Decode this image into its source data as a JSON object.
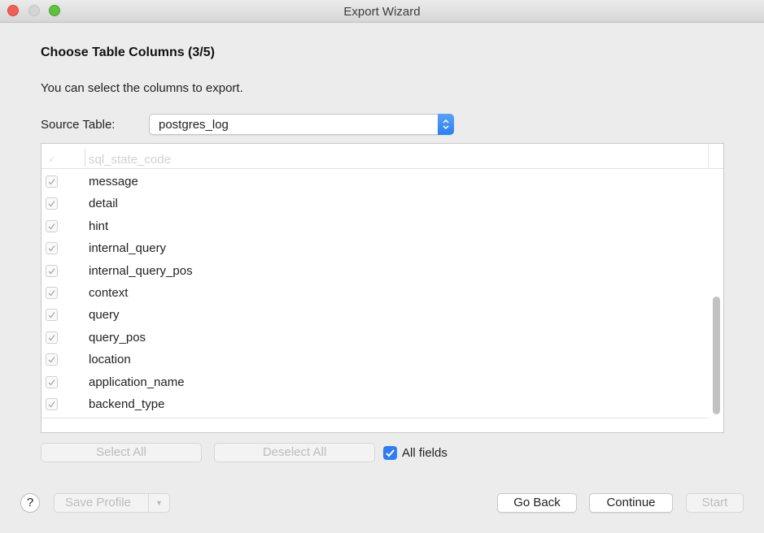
{
  "window": {
    "title": "Export Wizard"
  },
  "page": {
    "heading": "Choose Table Columns (3/5)",
    "description": "You can select the columns to export."
  },
  "source": {
    "label": "Source Table:",
    "value": "postgres_log"
  },
  "columns": {
    "header_partial": "sql_state_code",
    "items": [
      {
        "label": "message",
        "checked": true
      },
      {
        "label": "detail",
        "checked": true
      },
      {
        "label": "hint",
        "checked": true
      },
      {
        "label": "internal_query",
        "checked": true
      },
      {
        "label": "internal_query_pos",
        "checked": true
      },
      {
        "label": "context",
        "checked": true
      },
      {
        "label": "query",
        "checked": true
      },
      {
        "label": "query_pos",
        "checked": true
      },
      {
        "label": "location",
        "checked": true
      },
      {
        "label": "application_name",
        "checked": true
      },
      {
        "label": "backend_type",
        "checked": true
      }
    ]
  },
  "actions": {
    "select_all": "Select All",
    "deselect_all": "Deselect All",
    "all_fields": "All fields",
    "all_fields_checked": true
  },
  "footer": {
    "help": "?",
    "save_profile": "Save Profile",
    "go_back": "Go Back",
    "continue": "Continue",
    "start": "Start"
  },
  "colors": {
    "accent": "#2f7df6",
    "close": "#ee5f57",
    "maximize": "#5fc13e"
  },
  "icons": {
    "close": "close-icon",
    "minimize": "minimize-icon",
    "maximize": "maximize-icon",
    "checkmark": "checkmark-icon",
    "chevron": "chevron-updown-icon",
    "help": "help-icon",
    "dropdown": "chevron-down-icon"
  }
}
